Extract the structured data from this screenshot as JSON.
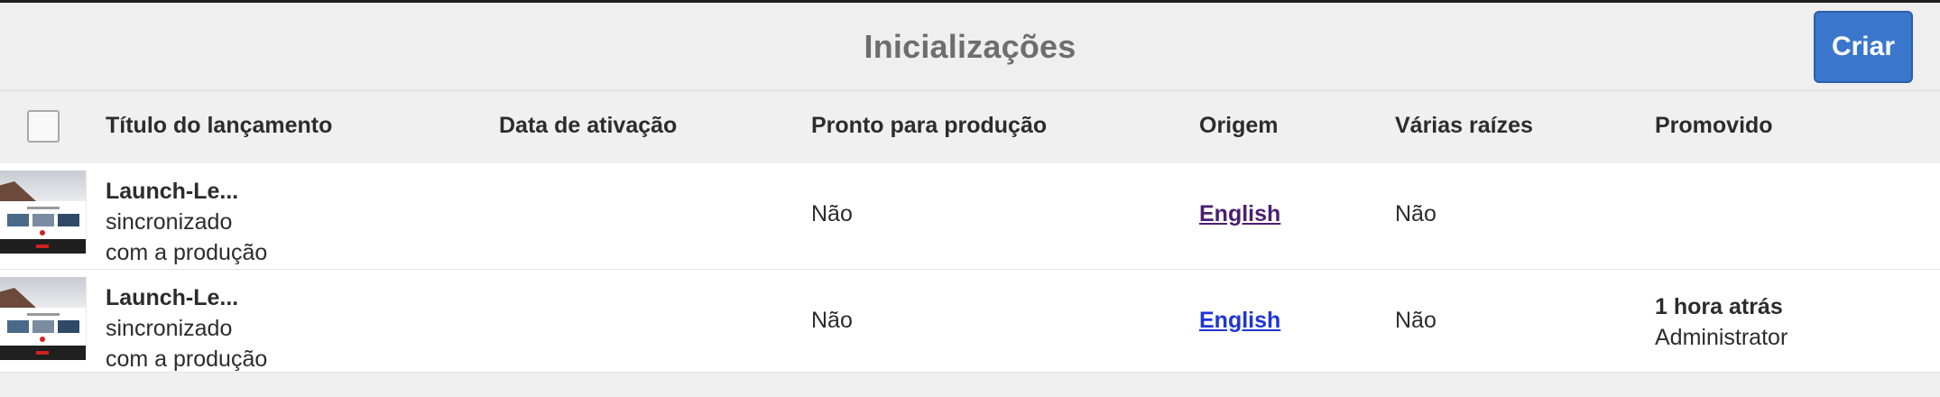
{
  "header": {
    "title": "Inicializações",
    "create_label": "Criar"
  },
  "columns": [
    "Título do lançamento",
    "Data de ativação",
    "Pronto para produção",
    "Origem",
    "Várias raízes",
    "Promovido"
  ],
  "rows": [
    {
      "title": "Launch-Le...",
      "status_line1": "sincronizado",
      "status_line2": "com a produção",
      "activation_date": "",
      "ready_for_production": "Não",
      "source": "English",
      "multiple_roots": "Não",
      "promoted_time": "",
      "promoted_by": ""
    },
    {
      "title": "Launch-Le...",
      "status_line1": "sincronizado",
      "status_line2": "com a produção",
      "activation_date": "",
      "ready_for_production": "Não",
      "source": "English",
      "multiple_roots": "Não",
      "promoted_time": "1 hora atrás",
      "promoted_by": "Administrator"
    }
  ],
  "colors": {
    "primary_button": "#3a76cc",
    "link_visited": "#4b1f6f",
    "link_unvisited": "#1f35d4"
  }
}
